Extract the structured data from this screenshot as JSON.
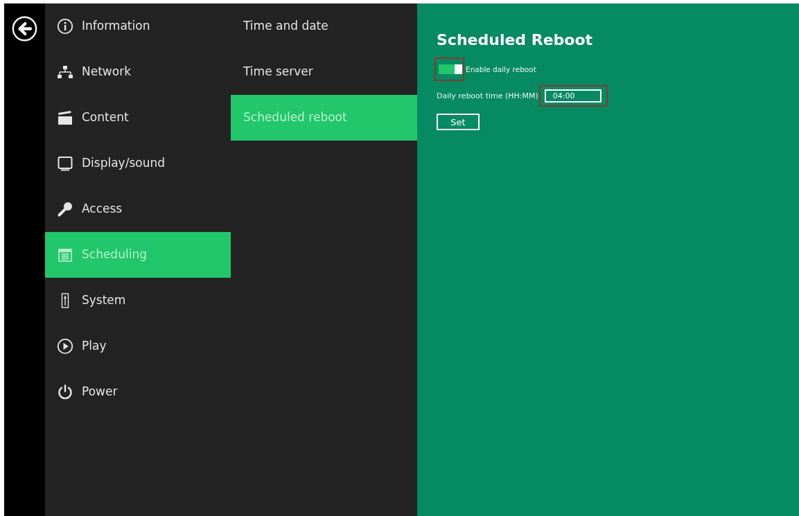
{
  "sidebar": {
    "items": [
      {
        "label": "Information",
        "selected": false
      },
      {
        "label": "Network",
        "selected": false
      },
      {
        "label": "Content",
        "selected": false
      },
      {
        "label": "Display/sound",
        "selected": false
      },
      {
        "label": "Access",
        "selected": false
      },
      {
        "label": "Scheduling",
        "selected": true
      },
      {
        "label": "System",
        "selected": false
      },
      {
        "label": "Play",
        "selected": false
      },
      {
        "label": "Power",
        "selected": false
      }
    ]
  },
  "submenu": {
    "items": [
      {
        "label": "Time and date",
        "selected": false
      },
      {
        "label": "Time server",
        "selected": false
      },
      {
        "label": "Scheduled reboot",
        "selected": true
      }
    ]
  },
  "panel": {
    "title": "Scheduled Reboot",
    "toggle": {
      "label": "Enable daily reboot",
      "on": true,
      "highlighted": true
    },
    "time_field": {
      "label": "Daily reboot time (HH:MM)",
      "value": "04:00",
      "highlighted": true
    },
    "buttons": [
      "Set"
    ]
  }
}
